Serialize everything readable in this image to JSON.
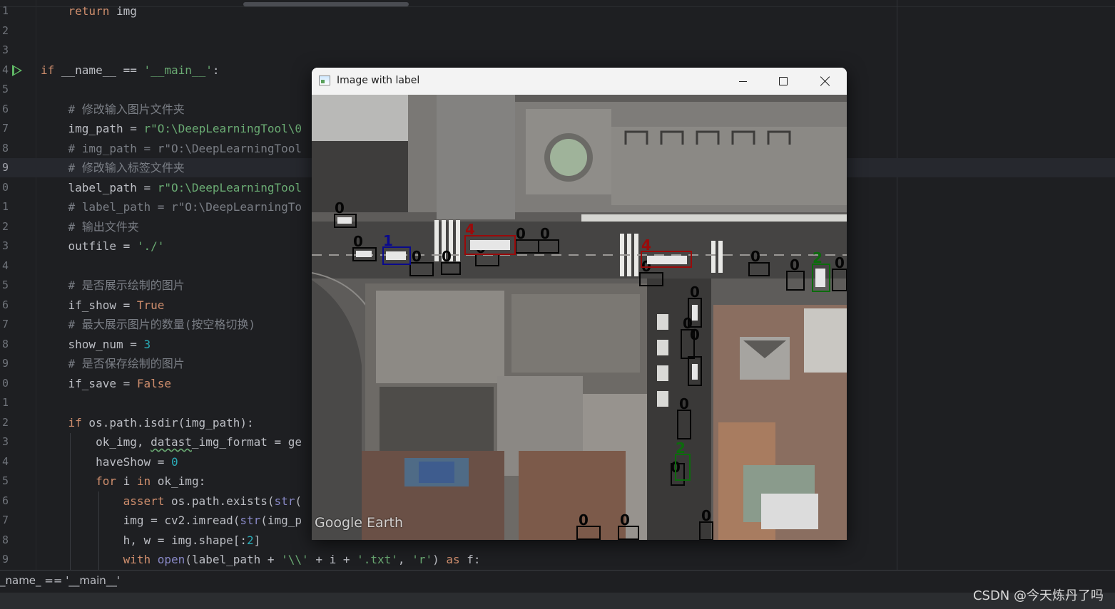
{
  "editor": {
    "lines": [
      {
        "num": "1",
        "html": "    <span class=\"kw\">return</span> img"
      },
      {
        "num": "2",
        "html": ""
      },
      {
        "num": "3",
        "html": ""
      },
      {
        "num": "4",
        "html": "<span class=\"kw\">if</span> __name__ == <span class=\"str\">'__main__'</span>:",
        "run": true
      },
      {
        "num": "5",
        "html": ""
      },
      {
        "num": "6",
        "html": "    <span class=\"cmt\"># 修改输入图片文件夹</span>"
      },
      {
        "num": "7",
        "html": "    img_path = <span class=\"str\">r\"O:\\DeepLearningTool\\0</span>"
      },
      {
        "num": "8",
        "html": "    <span class=\"cmt\"># img_path = r\"O:\\DeepLearningTool</span>"
      },
      {
        "num": "9",
        "html": "    <span class=\"cmt\"># 修改输入标签文件夹</span>",
        "current": true
      },
      {
        "num": "0",
        "html": "    label_path = <span class=\"str\">r\"O:\\DeepLearningTool</span>"
      },
      {
        "num": "1",
        "html": "    <span class=\"cmt\"># label_path = r\"O:\\DeepLearningTo</span>"
      },
      {
        "num": "2",
        "html": "    <span class=\"cmt\"># 输出文件夹</span>"
      },
      {
        "num": "3",
        "html": "    outfile = <span class=\"str\">'./'</span>"
      },
      {
        "num": "4",
        "html": ""
      },
      {
        "num": "5",
        "html": "    <span class=\"cmt\"># 是否展示绘制的图片</span>"
      },
      {
        "num": "6",
        "html": "    if_show = <span class=\"kw\">True</span>"
      },
      {
        "num": "7",
        "html": "    <span class=\"cmt\"># 最大展示图片的数量(按空格切换)</span>"
      },
      {
        "num": "8",
        "html": "    show_num = <span class=\"num\">3</span>"
      },
      {
        "num": "9",
        "html": "    <span class=\"cmt\"># 是否保存绘制的图片</span>"
      },
      {
        "num": "0",
        "html": "    if_save = <span class=\"kw\">False</span>"
      },
      {
        "num": "1",
        "html": ""
      },
      {
        "num": "2",
        "html": "    <span class=\"kw\">if</span> os.path.isdir(img_path):"
      },
      {
        "num": "3",
        "html": "        ok_img, <span class=\"squig\">datast</span>_img_format = ge"
      },
      {
        "num": "4",
        "html": "        haveShow = <span class=\"num\">0</span>"
      },
      {
        "num": "5",
        "html": "        <span class=\"kw\">for</span> i <span class=\"kw\">in</span> ok_img:"
      },
      {
        "num": "6",
        "html": "            <span class=\"kw\">assert</span> os.path.exists(<span class=\"bi\">str</span>("
      },
      {
        "num": "7",
        "html": "            img = cv2.imread(<span class=\"bi\">str</span>(img_p"
      },
      {
        "num": "8",
        "html": "            h, w = img.shape[:<span class=\"num\">2</span>]"
      },
      {
        "num": "9",
        "html": "            <span class=\"kw\">with</span> <span class=\"bi\">open</span>(label_path + <span class=\"str\">'\\\\'</span> + i + <span class=\"str\">'.txt'</span>, <span class=\"str\">'r'</span>) <span class=\"kw\">as</span> f:"
      }
    ]
  },
  "breadcrumb": "_name_ == '__main__'",
  "watermark": "CSDN @今天炼丹了吗",
  "window": {
    "title": "Image with label",
    "watermark_logo": "Google Earth"
  },
  "detections": [
    {
      "label": "0",
      "color": "#000000",
      "row": "street-upper"
    },
    {
      "label": "1",
      "color": "#0a0a8c",
      "row": "street-upper"
    },
    {
      "label": "4",
      "color": "#9a0a0a",
      "row": "street-upper"
    },
    {
      "label": "2",
      "color": "#0c6b0c",
      "row": "street-right"
    }
  ],
  "colors": {
    "editor_bg": "#1e1f22",
    "keyword": "#cf8e6d",
    "string": "#6aab73",
    "comment": "#7a7e85",
    "number": "#2aacb8"
  }
}
